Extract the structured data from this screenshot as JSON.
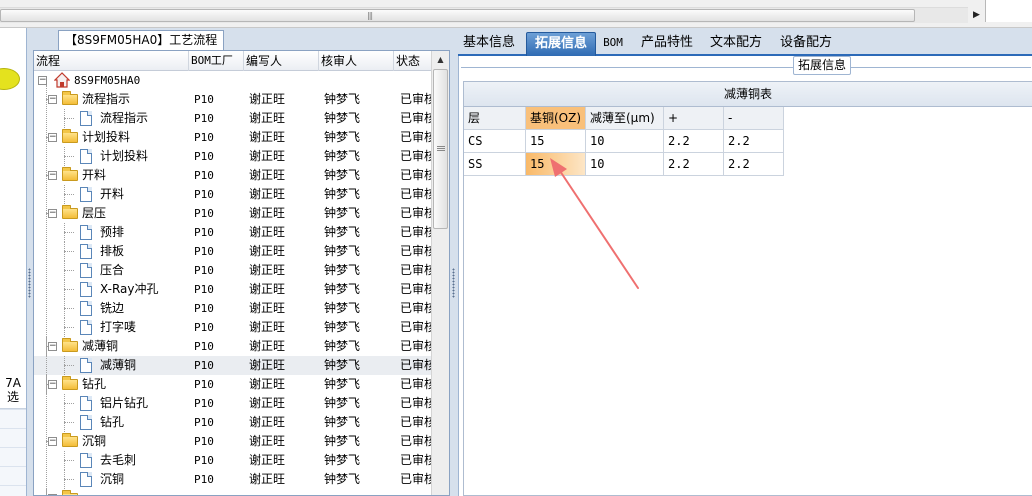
{
  "process_panel": {
    "tab_label": "【8S9FM05HA0】工艺流程",
    "columns": [
      "流程",
      "BOM工厂",
      "编写人",
      "核审人",
      "状态"
    ],
    "rows": [
      {
        "label": "8S9FM05HA0",
        "level": 0,
        "icon": "home-icon",
        "factory": "",
        "author": "",
        "reviewer": "",
        "status": ""
      },
      {
        "label": "流程指示",
        "level": 1,
        "icon": "folder-icon",
        "factory": "P10",
        "author": "谢正旺",
        "reviewer": "钟梦飞",
        "status": "已审核"
      },
      {
        "label": "流程指示",
        "level": 2,
        "icon": "document-icon",
        "factory": "P10",
        "author": "谢正旺",
        "reviewer": "钟梦飞",
        "status": "已审核"
      },
      {
        "label": "计划投料",
        "level": 1,
        "icon": "folder-icon",
        "factory": "P10",
        "author": "谢正旺",
        "reviewer": "钟梦飞",
        "status": "已审核"
      },
      {
        "label": "计划投料",
        "level": 2,
        "icon": "document-icon",
        "factory": "P10",
        "author": "谢正旺",
        "reviewer": "钟梦飞",
        "status": "已审核"
      },
      {
        "label": "开料",
        "level": 1,
        "icon": "folder-icon",
        "factory": "P10",
        "author": "谢正旺",
        "reviewer": "钟梦飞",
        "status": "已审核"
      },
      {
        "label": "开料",
        "level": 2,
        "icon": "document-icon",
        "factory": "P10",
        "author": "谢正旺",
        "reviewer": "钟梦飞",
        "status": "已审核"
      },
      {
        "label": "层压",
        "level": 1,
        "icon": "folder-icon",
        "factory": "P10",
        "author": "谢正旺",
        "reviewer": "钟梦飞",
        "status": "已审核"
      },
      {
        "label": "预排",
        "level": 2,
        "icon": "document-icon",
        "factory": "P10",
        "author": "谢正旺",
        "reviewer": "钟梦飞",
        "status": "已审核"
      },
      {
        "label": "排板",
        "level": 2,
        "icon": "document-icon",
        "factory": "P10",
        "author": "谢正旺",
        "reviewer": "钟梦飞",
        "status": "已审核"
      },
      {
        "label": "压合",
        "level": 2,
        "icon": "document-icon",
        "factory": "P10",
        "author": "谢正旺",
        "reviewer": "钟梦飞",
        "status": "已审核"
      },
      {
        "label": "X-Ray冲孔",
        "level": 2,
        "icon": "document-icon",
        "factory": "P10",
        "author": "谢正旺",
        "reviewer": "钟梦飞",
        "status": "已审核"
      },
      {
        "label": "铣边",
        "level": 2,
        "icon": "document-icon",
        "factory": "P10",
        "author": "谢正旺",
        "reviewer": "钟梦飞",
        "status": "已审核"
      },
      {
        "label": "打字唛",
        "level": 2,
        "icon": "document-icon",
        "factory": "P10",
        "author": "谢正旺",
        "reviewer": "钟梦飞",
        "status": "已审核"
      },
      {
        "label": "减薄铜",
        "level": 1,
        "icon": "folder-icon",
        "factory": "P10",
        "author": "谢正旺",
        "reviewer": "钟梦飞",
        "status": "已审核"
      },
      {
        "label": "减薄铜",
        "level": 2,
        "icon": "document-icon",
        "factory": "P10",
        "author": "谢正旺",
        "reviewer": "钟梦飞",
        "status": "已审核",
        "selected": true
      },
      {
        "label": "钻孔",
        "level": 1,
        "icon": "folder-icon",
        "factory": "P10",
        "author": "谢正旺",
        "reviewer": "钟梦飞",
        "status": "已审核"
      },
      {
        "label": "铝片钻孔",
        "level": 2,
        "icon": "document-icon",
        "factory": "P10",
        "author": "谢正旺",
        "reviewer": "钟梦飞",
        "status": "已审核"
      },
      {
        "label": "钻孔",
        "level": 2,
        "icon": "document-icon",
        "factory": "P10",
        "author": "谢正旺",
        "reviewer": "钟梦飞",
        "status": "已审核"
      },
      {
        "label": "沉铜",
        "level": 1,
        "icon": "folder-icon",
        "factory": "P10",
        "author": "谢正旺",
        "reviewer": "钟梦飞",
        "status": "已审核"
      },
      {
        "label": "去毛刺",
        "level": 2,
        "icon": "document-icon",
        "factory": "P10",
        "author": "谢正旺",
        "reviewer": "钟梦飞",
        "status": "已审核"
      },
      {
        "label": "沉铜",
        "level": 2,
        "icon": "document-icon",
        "factory": "P10",
        "author": "谢正旺",
        "reviewer": "钟梦飞",
        "status": "已审核"
      },
      {
        "label": "",
        "level": 1,
        "icon": "folder-icon",
        "factory": "",
        "author": "",
        "reviewer": "",
        "status": ""
      }
    ]
  },
  "left_panel": {
    "label_line1": "7A",
    "label_line2": "选"
  },
  "detail_panel": {
    "tabs": [
      {
        "label": "基本信息",
        "active": false
      },
      {
        "label": "拓展信息",
        "active": true
      },
      {
        "label": "BOM",
        "active": false
      },
      {
        "label": "产品特性",
        "active": false
      },
      {
        "label": "文本配方",
        "active": false
      },
      {
        "label": "设备配方",
        "active": false
      }
    ],
    "group_label": "拓展信息",
    "table": {
      "caption": "减薄铜表",
      "columns": [
        "层",
        "基铜(OZ)",
        "减薄至(μm)",
        "+",
        "-"
      ],
      "rows": [
        [
          "CS",
          "15",
          "10",
          "2.2",
          "2.2"
        ],
        [
          "SS",
          "15",
          "10",
          "2.2",
          "2.2"
        ]
      ]
    }
  },
  "colors": {
    "accent_tab": "#2f6bb3",
    "highlight_header": "#f9c07a",
    "annotation_arrow": "#ef7070"
  }
}
